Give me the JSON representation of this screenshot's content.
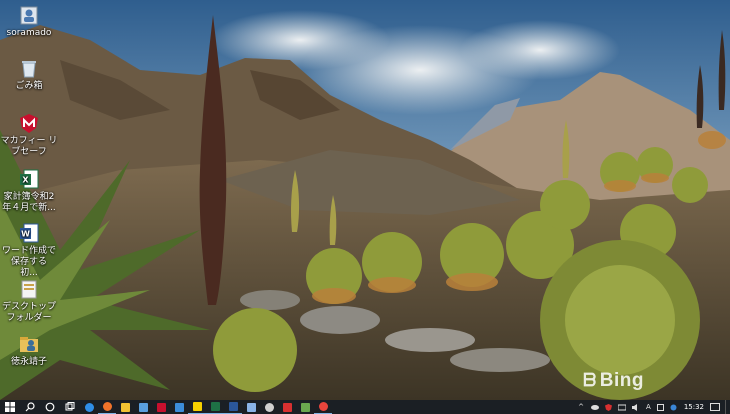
{
  "desktop": {
    "icons": [
      {
        "label": "soramado",
        "icon": "folder-user-icon"
      },
      {
        "label": "ごみ箱",
        "icon": "recycle-bin-icon"
      },
      {
        "label": "マカフィー リブセーフ",
        "icon": "mcafee-icon"
      },
      {
        "label": "家計簿令和2年４月で新...",
        "icon": "excel-icon"
      },
      {
        "label": "ワード作成で保存する　初...",
        "icon": "word-icon"
      },
      {
        "label": "デスクトップフォルダー",
        "icon": "desktop-folder-icon"
      },
      {
        "label": "徳永靖子",
        "icon": "user-folder-icon"
      }
    ]
  },
  "wallpaper": {
    "watermark": "Bing"
  },
  "taskbar": {
    "apps": [
      {
        "name": "start-button",
        "icon": "windows-logo-icon",
        "color": "#ffffff"
      },
      {
        "name": "search-button",
        "icon": "search-icon",
        "color": "#ffffff"
      },
      {
        "name": "cortana-button",
        "icon": "cortana-circle-icon",
        "color": "#ffffff"
      },
      {
        "name": "task-view-button",
        "icon": "task-view-icon",
        "color": "#ffffff"
      },
      {
        "name": "edge-app",
        "icon": "edge-icon",
        "color": "#2f8ee8"
      },
      {
        "name": "firefox-app",
        "icon": "firefox-icon",
        "color": "#f0732a"
      },
      {
        "name": "file-explorer-app",
        "icon": "folder-icon",
        "color": "#f1c232"
      },
      {
        "name": "store-app",
        "icon": "store-icon",
        "color": "#5aa0e0"
      },
      {
        "name": "mcafee-app",
        "icon": "mcafee-icon",
        "color": "#c8102e"
      },
      {
        "name": "mail-app",
        "icon": "mail-icon",
        "color": "#3c8ddb"
      },
      {
        "name": "sticky-notes-app",
        "icon": "sticky-note-icon",
        "color": "#f5d000"
      },
      {
        "name": "excel-app",
        "icon": "excel-icon",
        "color": "#1e7145"
      },
      {
        "name": "word-app",
        "icon": "word-icon",
        "color": "#2b579a"
      },
      {
        "name": "photos-app",
        "icon": "photos-icon",
        "color": "#8ab4e8"
      },
      {
        "name": "settings-app",
        "icon": "gear-icon",
        "color": "#d0d0d0"
      },
      {
        "name": "jcom-app",
        "icon": "jcom-icon",
        "color": "#d83030"
      },
      {
        "name": "paint-app",
        "icon": "paint-icon",
        "color": "#6aa84f"
      },
      {
        "name": "chrome-app",
        "icon": "chrome-icon",
        "color": "#e8453c"
      }
    ],
    "tray": {
      "chevron": "^",
      "ime_mode": "A",
      "clock": "15:32"
    }
  }
}
